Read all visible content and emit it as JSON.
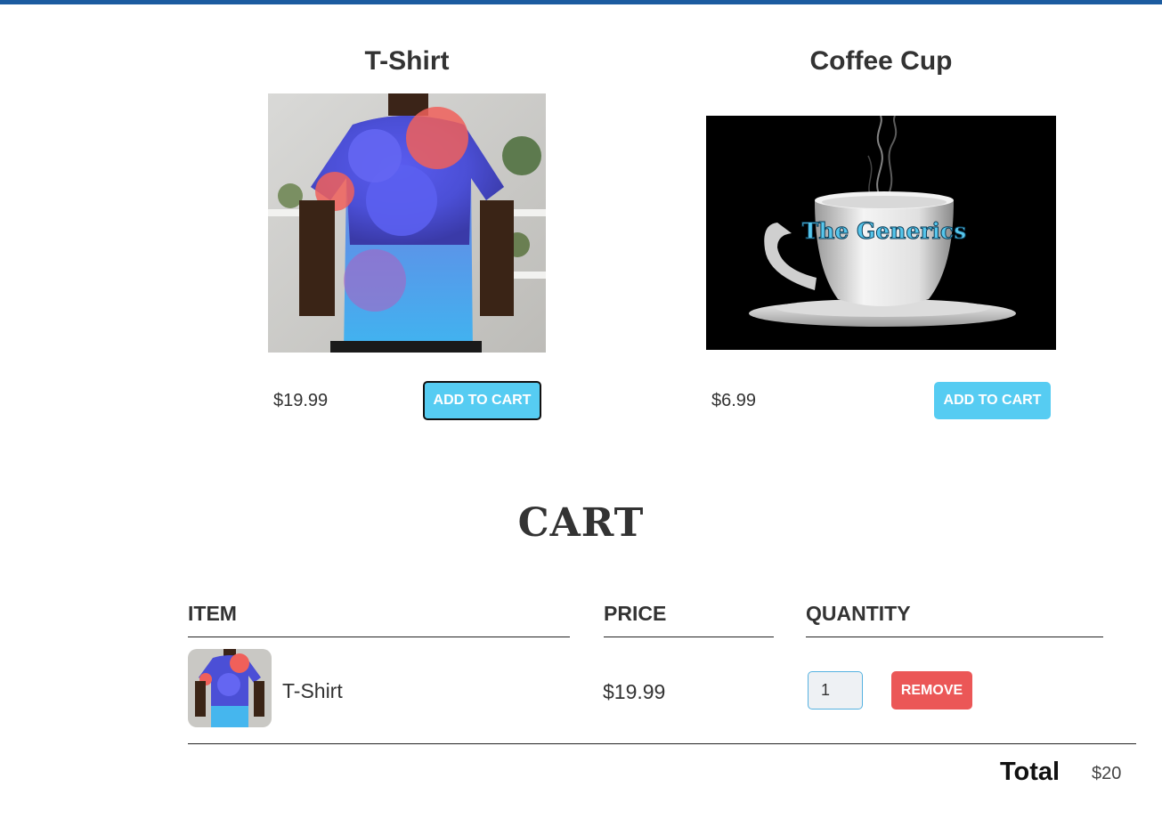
{
  "products": [
    {
      "title": "T-Shirt",
      "price": "$19.99",
      "add_button": "ADD TO CART",
      "image_icon": "tshirt-image"
    },
    {
      "title": "Coffee Cup",
      "price": "$6.99",
      "add_button": "ADD TO CART",
      "image_icon": "coffee-cup-image",
      "image_text": "The Generics"
    }
  ],
  "cart": {
    "heading": "CART",
    "columns": {
      "item": "ITEM",
      "price": "PRICE",
      "quantity": "QUANTITY"
    },
    "rows": [
      {
        "name": "T-Shirt",
        "price": "$19.99",
        "quantity": "1",
        "remove_button": "REMOVE"
      }
    ],
    "total_label": "Total",
    "total_value": "$20"
  },
  "colors": {
    "topbar": "#1c5ca0",
    "add_button": "#56ccf2",
    "remove_button": "#eb5757"
  }
}
